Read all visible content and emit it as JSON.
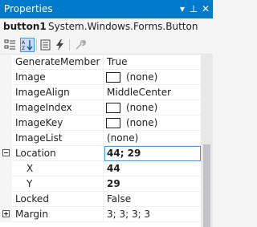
{
  "window": {
    "title": "Properties",
    "dropdown_glyph": "▾",
    "pin_glyph": "⊥",
    "close_glyph": "✕"
  },
  "object_selector": {
    "name": "button1",
    "type": "System.Windows.Forms.Button"
  },
  "toolbar": {
    "buttons": [
      {
        "icon": "categorized-icon",
        "active": false
      },
      {
        "icon": "alphabetical-icon",
        "active": true
      },
      {
        "icon": "properties-icon",
        "active": false
      },
      {
        "icon": "events-icon",
        "active": false
      },
      {
        "icon": "property-pages-icon",
        "active": false
      }
    ]
  },
  "properties": [
    {
      "name": "GenerateMember",
      "value": "True"
    },
    {
      "name": "Image",
      "value": "(none)",
      "swatch": true
    },
    {
      "name": "ImageAlign",
      "value": "MiddleCenter"
    },
    {
      "name": "ImageIndex",
      "value": "(none)",
      "swatch": true
    },
    {
      "name": "ImageKey",
      "value": "(none)",
      "swatch": true
    },
    {
      "name": "ImageList",
      "value": "(none)"
    },
    {
      "name": "Location",
      "value": "44; 29",
      "expanded": true,
      "selected": true
    },
    {
      "name": "X",
      "value": "44",
      "child": true
    },
    {
      "name": "Y",
      "value": "29",
      "child": true
    },
    {
      "name": "Locked",
      "value": "False"
    },
    {
      "name": "Margin",
      "value": "3; 3; 3; 3",
      "collapsed": true
    }
  ],
  "colors": {
    "accent": "#007acc",
    "selection": "#3399ff"
  }
}
